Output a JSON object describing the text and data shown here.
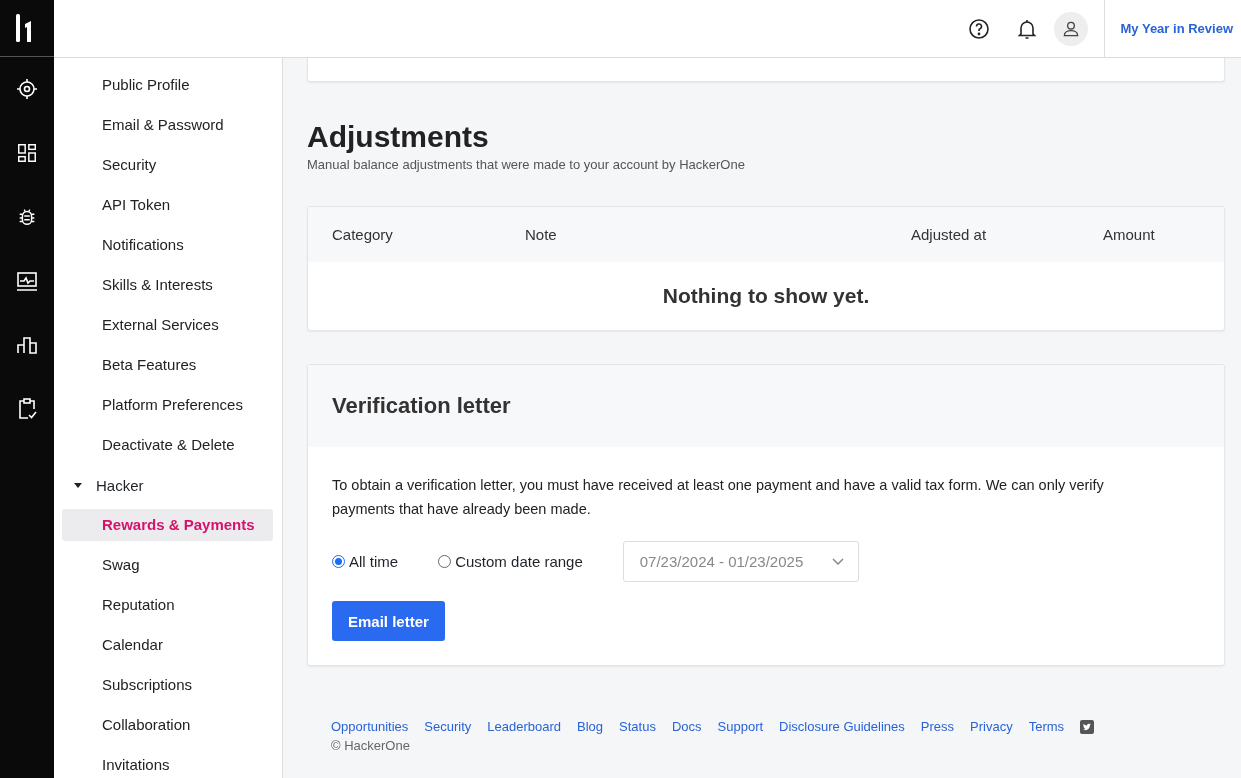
{
  "topbar": {
    "link": "My Year in Review"
  },
  "sidebar": {
    "items": [
      {
        "label": "Public Profile",
        "selected": false
      },
      {
        "label": "Email & Password",
        "selected": false
      },
      {
        "label": "Security",
        "selected": false
      },
      {
        "label": "API Token",
        "selected": false
      },
      {
        "label": "Notifications",
        "selected": false
      },
      {
        "label": "Skills & Interests",
        "selected": false
      },
      {
        "label": "External Services",
        "selected": false
      },
      {
        "label": "Beta Features",
        "selected": false
      },
      {
        "label": "Platform Preferences",
        "selected": false
      },
      {
        "label": "Deactivate & Delete",
        "selected": false
      },
      {
        "label": "Hacker",
        "expanded": true,
        "children": [
          {
            "label": "Rewards & Payments",
            "selected": true
          },
          {
            "label": "Swag",
            "selected": false
          },
          {
            "label": "Reputation",
            "selected": false
          },
          {
            "label": "Calendar",
            "selected": false
          },
          {
            "label": "Subscriptions",
            "selected": false
          },
          {
            "label": "Collaboration",
            "selected": false
          },
          {
            "label": "Invitations",
            "selected": false
          }
        ]
      }
    ]
  },
  "adjustments": {
    "title": "Adjustments",
    "subtitle": "Manual balance adjustments that were made to your account by HackerOne",
    "table": {
      "columns": [
        "Category",
        "Note",
        "Adjusted at",
        "Amount"
      ],
      "empty_message": "Nothing to show yet."
    }
  },
  "verification": {
    "title": "Verification letter",
    "text": "To obtain a verification letter, you must have received at least one payment and have a valid tax form. We can only verify payments that have already been made.",
    "options": [
      {
        "label": "All time",
        "selected": true
      },
      {
        "label": "Custom date range",
        "selected": false
      }
    ],
    "date_range": {
      "value": "07/23/2024 - 01/23/2025",
      "disabled": true
    },
    "button": "Email letter"
  },
  "footer": {
    "links": [
      "Opportunities",
      "Security",
      "Leaderboard",
      "Blog",
      "Status",
      "Docs",
      "Support",
      "Disclosure Guidelines",
      "Press",
      "Privacy",
      "Terms"
    ],
    "copyright": "© HackerOne"
  }
}
